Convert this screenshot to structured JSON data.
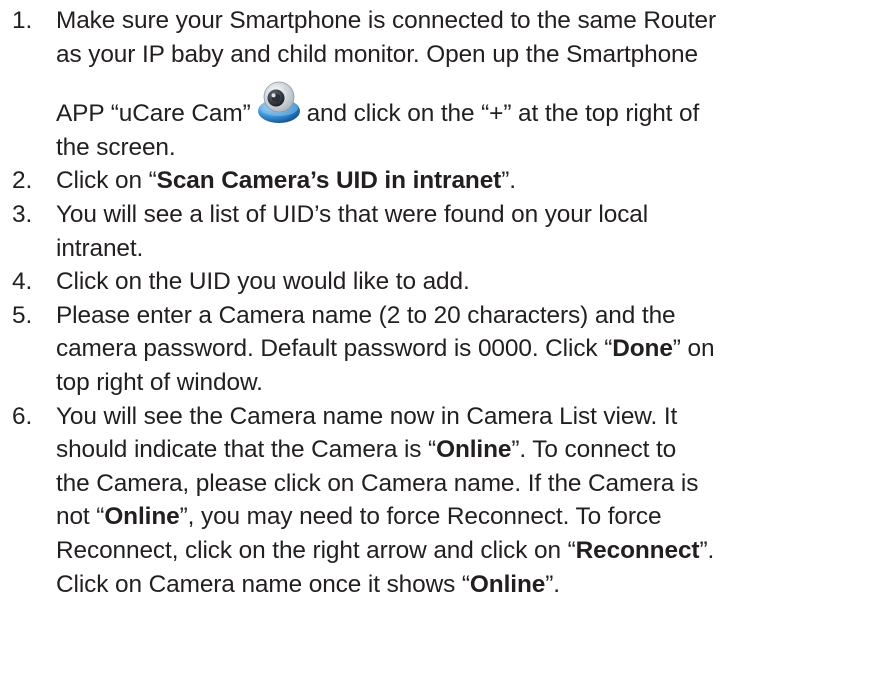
{
  "steps": [
    {
      "number": "1.",
      "line1": "Make sure your Smartphone is connected to the same Router",
      "line2": "as your IP baby and child monitor. Open up the Smartphone",
      "line3_a": "APP “uCare Cam”",
      "line3_b": "and click on the “+” at the top right of",
      "line4": "the screen.",
      "icon": "ucare-cam-app-icon"
    },
    {
      "number": "2.",
      "pre": "Click on “",
      "bold": "Scan Camera’s UID in intranet",
      "post": "”."
    },
    {
      "number": "3.",
      "line1": "You will see a list of UID’s that were found on your local",
      "line2": "intranet."
    },
    {
      "number": "4.",
      "text": "Click on the UID you would like to add."
    },
    {
      "number": "5.",
      "line1": "Please enter a Camera name (2 to 20 characters) and the",
      "line2": "camera password. Default password is 0000. Click “",
      "line2_bold": "Done",
      "line2_post": "” on",
      "line3": "top right of window."
    },
    {
      "number": "6.",
      "line1": "You will see the Camera name now in Camera List view. It",
      "line2_pre": "should indicate that the Camera is “",
      "online": "Online",
      "line2_post": "”. To connect to",
      "line3": "the Camera, please click on Camera name. If the Camera is",
      "line4_pre": "not “",
      "line4_post": "”, you may need to force Reconnect. To force",
      "line5_pre": "Reconnect, click on the right arrow and click on “",
      "reconnect": "Reconnect",
      "line5_post": "”.",
      "line6_pre": "Click on Camera name once it shows “",
      "line6_post": "”."
    }
  ]
}
